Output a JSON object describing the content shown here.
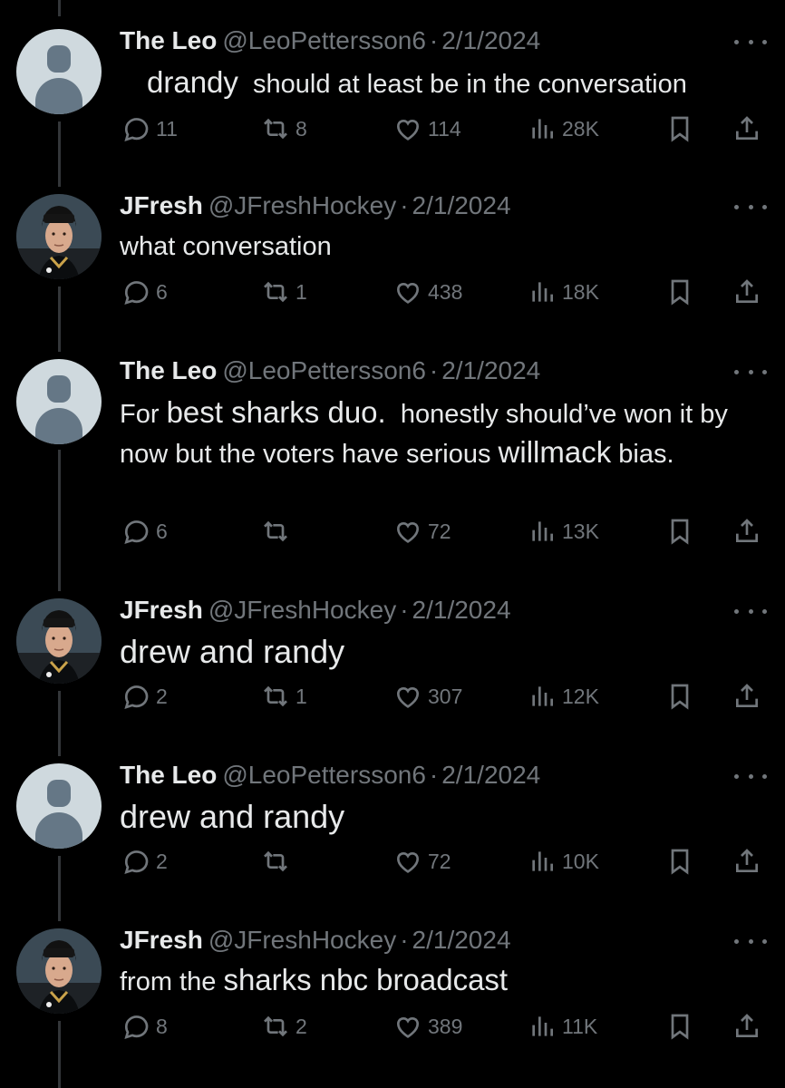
{
  "colors": {
    "background": "#000000",
    "text_primary": "#e7e9ea",
    "text_secondary": "#71767b",
    "thread_line": "#333639"
  },
  "tweets": [
    {
      "name": "The Leo",
      "handle": "@LeoPettersson6",
      "date": "2/1/2024",
      "avatar": "default-avatar",
      "text_parts": [
        "drandy",
        "should at least be in the conversation"
      ],
      "replies": "11",
      "reposts": "8",
      "likes": "114",
      "views": "28K"
    },
    {
      "name": "JFresh",
      "handle": "@JFreshHockey",
      "date": "2/1/2024",
      "avatar": "hockey-player-photo",
      "text_parts": [
        "what conversation"
      ],
      "replies": "6",
      "reposts": "1",
      "likes": "438",
      "views": "18K"
    },
    {
      "name": "The Leo",
      "handle": "@LeoPettersson6",
      "date": "2/1/2024",
      "avatar": "default-avatar",
      "text_parts": [
        "For",
        "best sharks duo.",
        "honestly should’ve won it by now but the voters have serious",
        "willmack",
        "bias."
      ],
      "replies": "6",
      "reposts": "",
      "likes": "72",
      "views": "13K"
    },
    {
      "name": "JFresh",
      "handle": "@JFreshHockey",
      "date": "2/1/2024",
      "avatar": "hockey-player-photo",
      "text_parts": [
        "drew and randy"
      ],
      "replies": "2",
      "reposts": "1",
      "likes": "307",
      "views": "12K"
    },
    {
      "name": "The Leo",
      "handle": "@LeoPettersson6",
      "date": "2/1/2024",
      "avatar": "default-avatar",
      "text_parts": [
        "drew and randy"
      ],
      "replies": "2",
      "reposts": "",
      "likes": "72",
      "views": "10K"
    },
    {
      "name": "JFresh",
      "handle": "@JFreshHockey",
      "date": "2/1/2024",
      "avatar": "hockey-player-photo",
      "text_parts": [
        "from the",
        "sharks nbc broadcast"
      ],
      "replies": "8",
      "reposts": "2",
      "likes": "389",
      "views": "11K"
    }
  ]
}
